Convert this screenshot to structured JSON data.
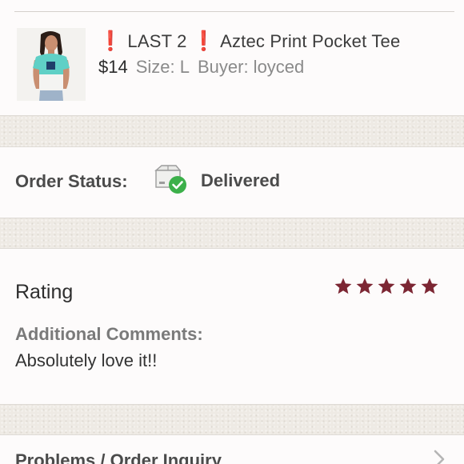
{
  "listing": {
    "badge_text": "LAST 2",
    "title": "Aztec Print Pocket Tee",
    "price": "$14",
    "size": "Size: L",
    "buyer": "Buyer: loyced",
    "thumbnail_icon": "product-photo"
  },
  "order_status": {
    "label": "Order Status:",
    "icon": "box-delivered-check-icon",
    "value": "Delivered"
  },
  "rating": {
    "label": "Rating",
    "stars": 5,
    "max_stars": 5,
    "star_color": "#7c2633",
    "comments_label": "Additional Comments:",
    "comments": "Absolutely love it!!"
  },
  "problems": {
    "label": "Problems / Order Inquiry",
    "icon": "chevron-right-icon"
  },
  "colors": {
    "accent_red": "#e0201b",
    "check_green": "#3cb04a",
    "star": "#7c2633"
  }
}
